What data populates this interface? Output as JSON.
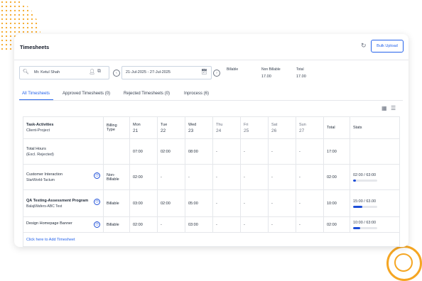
{
  "page": {
    "title": "Timesheets",
    "upload_label": "Bulk Upload"
  },
  "filters": {
    "employee": "Mr. Ketul Shah",
    "date_range": "21-Jul-2025 - 27-Jul-2025",
    "summary": {
      "billable_label": "Billable",
      "billable_value": "",
      "nonbillable_label": "Non Billable",
      "nonbillable_value": "17.00",
      "total_label": "Total",
      "total_value": "17.00"
    }
  },
  "tabs": [
    "All Timesheets",
    "Approved Timesheets (0)",
    "Rejected Timesheets (0)",
    "Inprocess (6)"
  ],
  "table": {
    "header": {
      "task_line1": "Task-Activities",
      "task_line2": "Client-Project",
      "billing_line1": "Billing",
      "billing_line2": "Type",
      "days": [
        {
          "name": "Mon",
          "num": "21"
        },
        {
          "name": "Tue",
          "num": "22"
        },
        {
          "name": "Wed",
          "num": "23"
        },
        {
          "name": "Thu",
          "num": "24"
        },
        {
          "name": "Fri",
          "num": "25"
        },
        {
          "name": "Sat",
          "num": "26"
        },
        {
          "name": "Sun",
          "num": "27"
        }
      ],
      "total": "Total",
      "stats": "Stats"
    },
    "total_row": {
      "label1": "Total Hours",
      "label2": "(Excl. Rejected)",
      "hours": [
        "07:00",
        "02:00",
        "08:00",
        "-",
        "-",
        "-",
        "-"
      ],
      "total": "17:00"
    },
    "rows": [
      {
        "task": "Customer Interaction",
        "client": "StarWorld-Tactum",
        "billing": "Non-Billable",
        "hours": [
          "02:00",
          "-",
          "-",
          "-",
          "-",
          "-",
          "-"
        ],
        "total": "02:00",
        "stats": "02:00 / 63:00",
        "progress": 0.12
      },
      {
        "task": "QA Testing-Assessment Program",
        "client": "BalajiWafers-ABC Test",
        "billing": "Billable",
        "hours": [
          "03:00",
          "02:00",
          "05:00",
          "-",
          "-",
          "-",
          "-"
        ],
        "total": "10:00",
        "stats": "15:00 / 63.00",
        "progress": 0.38
      },
      {
        "task": "Design Homepage Banner",
        "client": "",
        "billing": "Billable",
        "hours": [
          "02:00",
          "-",
          "03:00",
          "-",
          "-",
          "-",
          "-"
        ],
        "total": "02:00",
        "stats": "10:00 / 63:00",
        "progress": 0.28
      }
    ],
    "add_link": "Click here to Add Timesheet"
  },
  "colors": {
    "accent": "#2563eb",
    "deco": "#f5a623",
    "red": "#dc2626"
  }
}
